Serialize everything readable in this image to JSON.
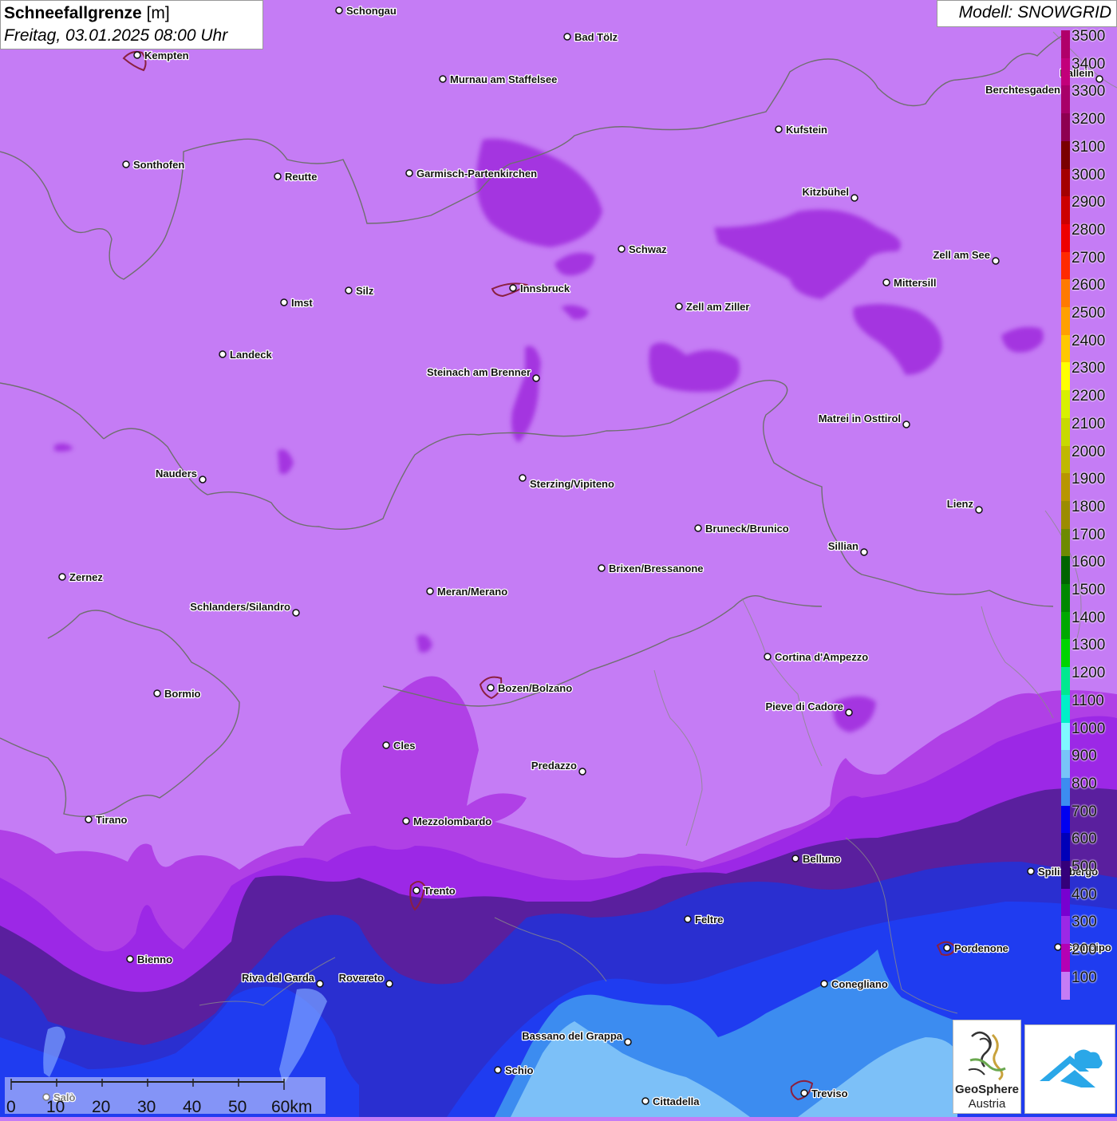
{
  "header": {
    "title_bold": "Schneefallgrenze",
    "title_unit": "[m]",
    "datetime": "Freitag, 03.01.2025 08:00 Uhr",
    "model": "Modell: SNOWGRID"
  },
  "legend": {
    "levels": [
      {
        "label": "3500",
        "color": "#b0006a"
      },
      {
        "label": "3400",
        "color": "#c2007a"
      },
      {
        "label": "3300",
        "color": "#a80068"
      },
      {
        "label": "3200",
        "color": "#8e0050"
      },
      {
        "label": "3100",
        "color": "#7a0000"
      },
      {
        "label": "3000",
        "color": "#a40000"
      },
      {
        "label": "2900",
        "color": "#cc0000"
      },
      {
        "label": "2800",
        "color": "#ee0000"
      },
      {
        "label": "2700",
        "color": "#ff2a00"
      },
      {
        "label": "2600",
        "color": "#ff7a00"
      },
      {
        "label": "2500",
        "color": "#ffa000"
      },
      {
        "label": "2400",
        "color": "#ffc800"
      },
      {
        "label": "2300",
        "color": "#ffff00"
      },
      {
        "label": "2200",
        "color": "#d8f000"
      },
      {
        "label": "2100",
        "color": "#c8d800"
      },
      {
        "label": "2000",
        "color": "#c0b800"
      },
      {
        "label": "1900",
        "color": "#b89600"
      },
      {
        "label": "1800",
        "color": "#9c8c00"
      },
      {
        "label": "1700",
        "color": "#6e8a00"
      },
      {
        "label": "1600",
        "color": "#006400"
      },
      {
        "label": "1500",
        "color": "#008800"
      },
      {
        "label": "1400",
        "color": "#00a800"
      },
      {
        "label": "1300",
        "color": "#00d400"
      },
      {
        "label": "1200",
        "color": "#00e890"
      },
      {
        "label": "1100",
        "color": "#00f0c8"
      },
      {
        "label": "1000",
        "color": "#7ff8ff"
      },
      {
        "label": "900",
        "color": "#78c4f8"
      },
      {
        "label": "800",
        "color": "#3c8cf0"
      },
      {
        "label": "700",
        "color": "#0000f0"
      },
      {
        "label": "600",
        "color": "#0000b8"
      },
      {
        "label": "500",
        "color": "#34007a"
      },
      {
        "label": "400",
        "color": "#7800d0"
      },
      {
        "label": "300",
        "color": "#9c28e6"
      },
      {
        "label": "200",
        "color": "#b400b4"
      },
      {
        "label": "100",
        "color": "#c57cf5"
      }
    ]
  },
  "cities": [
    {
      "name": "Schongau"
    },
    {
      "name": "Bad Tölz"
    },
    {
      "name": "Kempten"
    },
    {
      "name": "Murnau am Staffelsee"
    },
    {
      "name": "Hallein"
    },
    {
      "name": "Berchtesgaden"
    },
    {
      "name": "Kufstein"
    },
    {
      "name": "Sonthofen"
    },
    {
      "name": "Reutte"
    },
    {
      "name": "Garmisch-Partenkirchen"
    },
    {
      "name": "Kitzbühel"
    },
    {
      "name": "Schwaz"
    },
    {
      "name": "Zell am See"
    },
    {
      "name": "Mittersill"
    },
    {
      "name": "Innsbruck"
    },
    {
      "name": "Imst"
    },
    {
      "name": "Silz"
    },
    {
      "name": "Zell am Ziller"
    },
    {
      "name": "Landeck"
    },
    {
      "name": "Steinach am Brenner"
    },
    {
      "name": "Matrei in Osttirol"
    },
    {
      "name": "Nauders"
    },
    {
      "name": "Sterzing/Vipiteno"
    },
    {
      "name": "Lienz"
    },
    {
      "name": "Bruneck/Brunico"
    },
    {
      "name": "Sillian"
    },
    {
      "name": "Zernez"
    },
    {
      "name": "Brixen/Bressanone"
    },
    {
      "name": "Meran/Merano"
    },
    {
      "name": "Schlanders/Silandro"
    },
    {
      "name": "Cortina d'Ampezzo"
    },
    {
      "name": "Bormio"
    },
    {
      "name": "Bozen/Bolzano"
    },
    {
      "name": "Pieve di Cadore"
    },
    {
      "name": "Cles"
    },
    {
      "name": "Predazzo"
    },
    {
      "name": "Tirano"
    },
    {
      "name": "Mezzolombardo"
    },
    {
      "name": "Belluno"
    },
    {
      "name": "Spilimbergo"
    },
    {
      "name": "Trento"
    },
    {
      "name": "Feltre"
    },
    {
      "name": "Pordenone"
    },
    {
      "name": "Codroipo"
    },
    {
      "name": "Bienno"
    },
    {
      "name": "Riva del Garda"
    },
    {
      "name": "Rovereto"
    },
    {
      "name": "Conegliano"
    },
    {
      "name": "Bassano del Grappa"
    },
    {
      "name": "Schio"
    },
    {
      "name": "Treviso"
    },
    {
      "name": "Cittadella"
    },
    {
      "name": "Salò"
    }
  ],
  "scalebar": {
    "ticks": [
      "0",
      "10",
      "20",
      "30",
      "40",
      "50",
      "60km"
    ]
  },
  "logos": {
    "geosphere_line1": "GeoSphere",
    "geosphere_line2": "Austria"
  },
  "colors": {
    "base_100": "#c57cf5",
    "band_200": "#b040e6",
    "band_300": "#9c28e6",
    "band_400": "#5a1f9e",
    "band_600": "#2a2fd0",
    "band_700": "#1f3cf0",
    "band_800": "#3c8cf0",
    "band_900": "#7cc0f8",
    "patch": "#a436e0"
  }
}
